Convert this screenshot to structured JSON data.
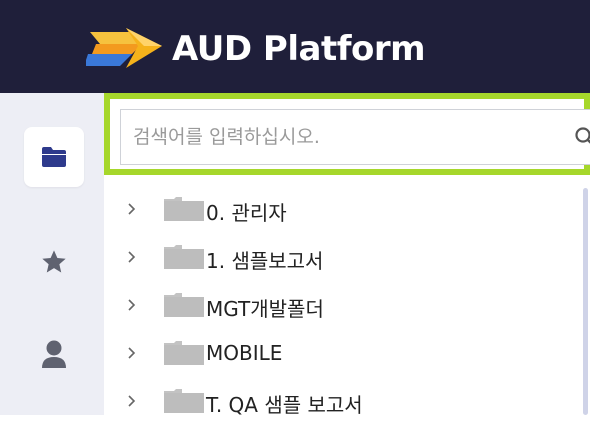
{
  "header": {
    "title": "AUD Platform",
    "colors": {
      "background": "#1f1f3a",
      "logo_gold": "#f5b21b",
      "logo_blue": "#3a78d8"
    }
  },
  "sidebar": {
    "items": [
      {
        "icon": "folder-icon",
        "active": true
      },
      {
        "icon": "star-icon",
        "active": false
      },
      {
        "icon": "user-icon",
        "active": false
      }
    ],
    "accent_color": "#2e3a8c"
  },
  "search": {
    "placeholder": "검색어를 입력하십시오.",
    "value": "",
    "highlight_color": "#a6d72b"
  },
  "tree": {
    "items": [
      {
        "label": "0. 관리자"
      },
      {
        "label": "1. 샘플보고서"
      },
      {
        "label": "MGT개발폴더"
      },
      {
        "label": "MOBILE"
      },
      {
        "label": "T. QA 샘플 보고서"
      }
    ]
  }
}
